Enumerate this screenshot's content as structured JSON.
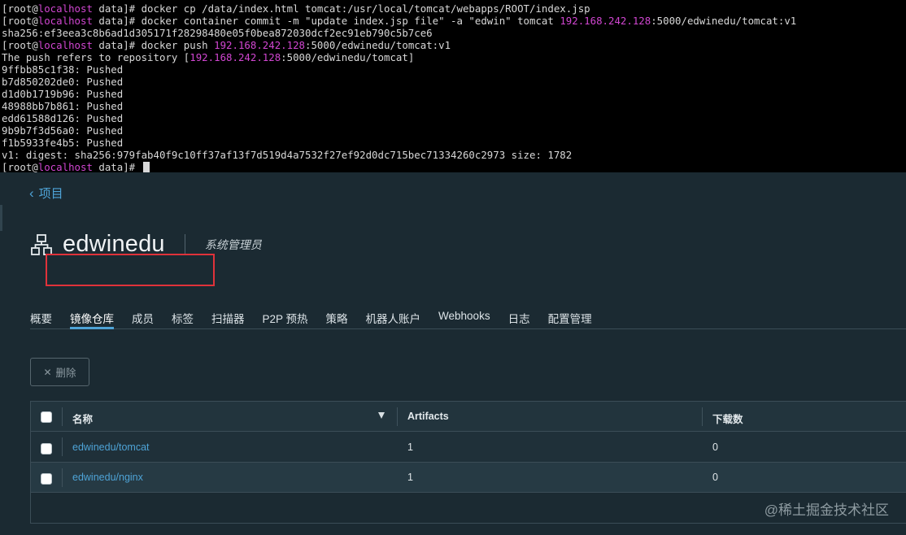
{
  "terminal": {
    "lines": [
      {
        "segments": [
          {
            "t": "[root@"
          },
          {
            "t": "localhost",
            "c": "mag"
          },
          {
            "t": " data]# docker cp /data/index.html tomcat:/usr/local/tomcat/webapps/ROOT/index.jsp"
          }
        ]
      },
      {
        "segments": [
          {
            "t": "[root@"
          },
          {
            "t": "localhost",
            "c": "mag"
          },
          {
            "t": " data]# docker container commit -m \"update index.jsp file\" -a \"edwin\" tomcat "
          },
          {
            "t": "192.168.242.128",
            "c": "mag"
          },
          {
            "t": ":5000/edwinedu/tomcat:v1"
          }
        ]
      },
      {
        "segments": [
          {
            "t": "sha256:ef3eea3c8b6ad1d305171f28298480e05f0bea872030dcf2ec91eb790c5b7ce6"
          }
        ]
      },
      {
        "segments": [
          {
            "t": "[root@"
          },
          {
            "t": "localhost",
            "c": "mag"
          },
          {
            "t": " data]# docker push "
          },
          {
            "t": "192.168.242.128",
            "c": "mag"
          },
          {
            "t": ":5000/edwinedu/tomcat:v1"
          }
        ]
      },
      {
        "segments": [
          {
            "t": "The push refers to repository ["
          },
          {
            "t": "192.168.242.128",
            "c": "mag"
          },
          {
            "t": ":5000/edwinedu/tomcat]"
          }
        ]
      },
      {
        "segments": [
          {
            "t": "9ffbb85c1f38: Pushed"
          }
        ]
      },
      {
        "segments": [
          {
            "t": "b7d850202de0: Pushed"
          }
        ]
      },
      {
        "segments": [
          {
            "t": "d1d0b1719b96: Pushed"
          }
        ]
      },
      {
        "segments": [
          {
            "t": "48988bb7b861: Pushed"
          }
        ]
      },
      {
        "segments": [
          {
            "t": "edd61588d126: Pushed"
          }
        ]
      },
      {
        "segments": [
          {
            "t": "9b9b7f3d56a0: Pushed"
          }
        ]
      },
      {
        "segments": [
          {
            "t": "f1b5933fe4b5: Pushed"
          }
        ]
      },
      {
        "segments": [
          {
            "t": "v1: digest: sha256:979fab40f9c10ff37af13f7d519d4a7532f27ef92d0dc715bec71334260c2973 size: 1782"
          }
        ]
      },
      {
        "segments": [
          {
            "t": "[root@"
          },
          {
            "t": "localhost",
            "c": "mag"
          },
          {
            "t": " data]# "
          }
        ],
        "cursor": true
      }
    ]
  },
  "nav": {
    "back_label": "项目"
  },
  "project": {
    "name": "edwinedu",
    "role": "系统管理员"
  },
  "tabs": [
    {
      "label": "概要",
      "id": "summary",
      "active": false
    },
    {
      "label": "镜像仓库",
      "id": "repositories",
      "active": true
    },
    {
      "label": "成员",
      "id": "members",
      "active": false
    },
    {
      "label": "标签",
      "id": "labels",
      "active": false
    },
    {
      "label": "扫描器",
      "id": "scanner",
      "active": false
    },
    {
      "label": "P2P 预热",
      "id": "p2p-preheat",
      "active": false
    },
    {
      "label": "策略",
      "id": "policy",
      "active": false
    },
    {
      "label": "机器人账户",
      "id": "robot-accounts",
      "active": false
    },
    {
      "label": "Webhooks",
      "id": "webhooks",
      "active": false
    },
    {
      "label": "日志",
      "id": "logs",
      "active": false
    },
    {
      "label": "配置管理",
      "id": "configuration",
      "active": false
    }
  ],
  "toolbar": {
    "delete_label": "删除"
  },
  "table": {
    "headers": {
      "name": "名称",
      "artifacts": "Artifacts",
      "downloads": "下载数"
    },
    "rows": [
      {
        "name": "edwinedu/tomcat",
        "artifacts": "1",
        "downloads": "0"
      },
      {
        "name": "edwinedu/nginx",
        "artifacts": "1",
        "downloads": "0"
      }
    ]
  },
  "watermark": "@稀土掘金技术社区",
  "colors": {
    "accent": "#4ea3d6",
    "highlight": "#e0323a",
    "terminal_host": "#d146d1",
    "background": "#1b2a32"
  }
}
